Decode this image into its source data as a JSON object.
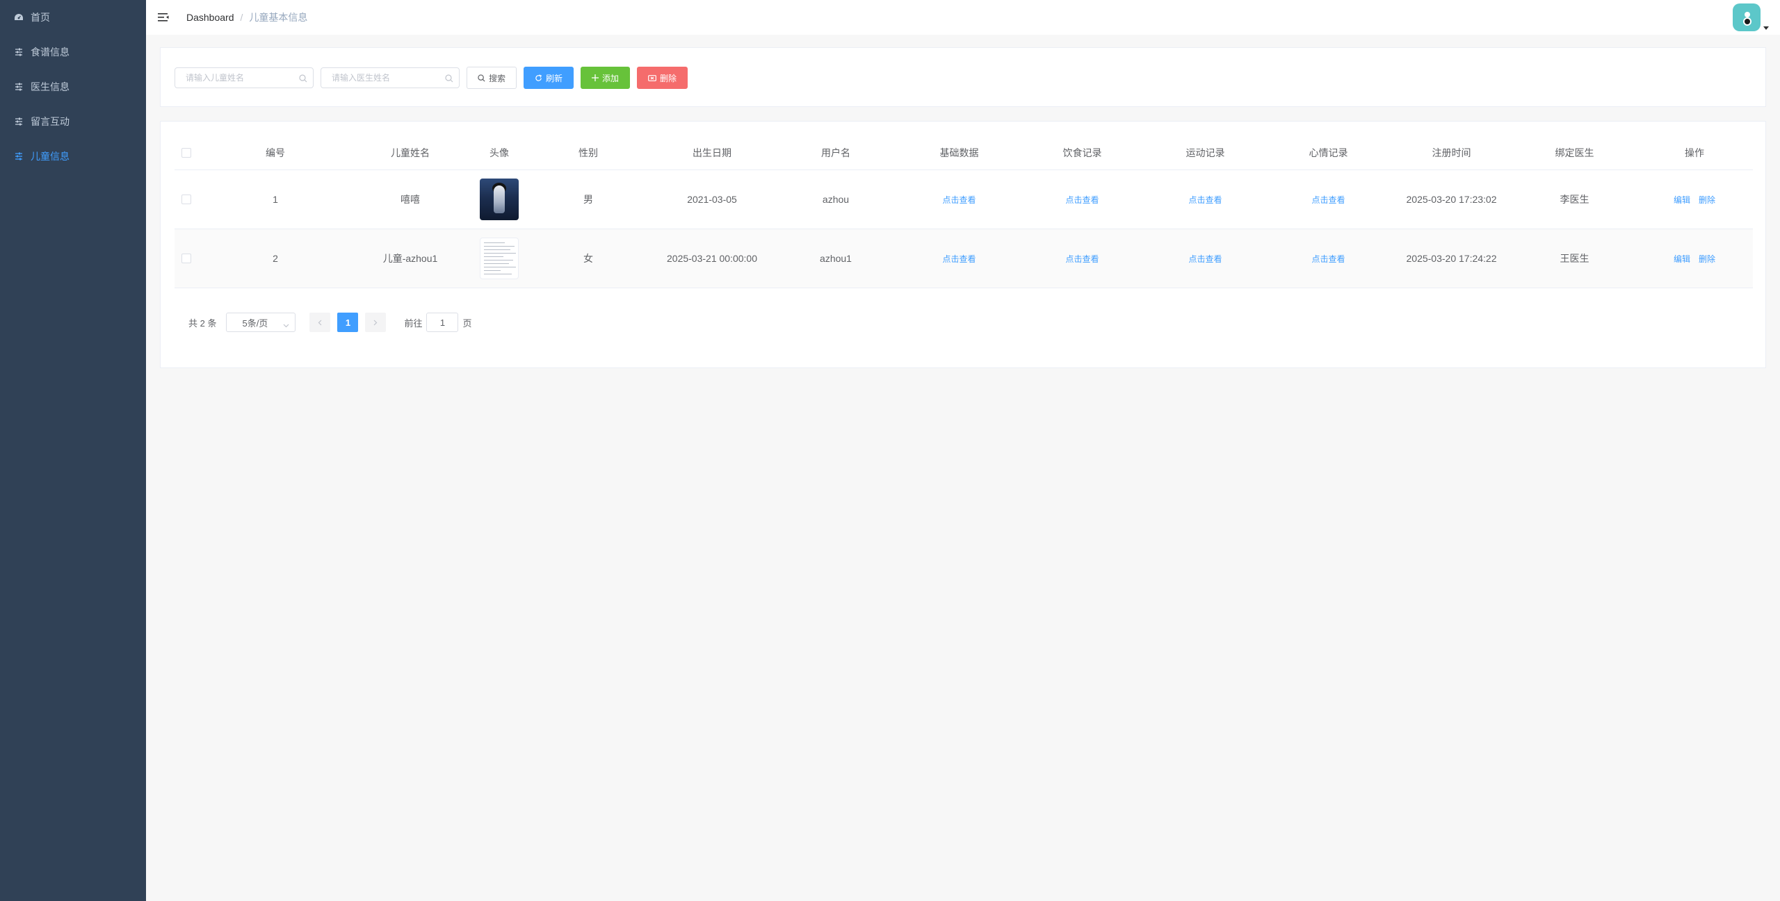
{
  "sidebar": {
    "items": [
      {
        "label": "首页",
        "icon": "dashboard-icon",
        "active": false
      },
      {
        "label": "食谱信息",
        "icon": "sliders-icon",
        "active": false
      },
      {
        "label": "医生信息",
        "icon": "sliders-icon",
        "active": false
      },
      {
        "label": "留言互动",
        "icon": "sliders-icon",
        "active": false
      },
      {
        "label": "儿童信息",
        "icon": "sliders-icon",
        "active": true
      }
    ]
  },
  "navbar": {
    "breadcrumb": {
      "root": "Dashboard",
      "separator": "/",
      "current": "儿童基本信息"
    },
    "avatar_icon": "user-avatar-icon"
  },
  "search": {
    "child_name_placeholder": "请输入儿童姓名",
    "doctor_name_placeholder": "请输入医生姓名",
    "search_label": "搜索",
    "refresh_label": "刷新",
    "add_label": "添加",
    "delete_label": "删除"
  },
  "table": {
    "headers": {
      "no": "编号",
      "name": "儿童姓名",
      "avatar": "头像",
      "sex": "性别",
      "birth": "出生日期",
      "user": "用户名",
      "base": "基础数据",
      "diet": "饮食记录",
      "sport": "运动记录",
      "mood": "心情记录",
      "reg": "注册时间",
      "doctor": "绑定医生",
      "op": "操作"
    },
    "rows": [
      {
        "no": "1",
        "name": "嘻嘻",
        "sex": "男",
        "birth": "2021-03-05",
        "user": "azhou",
        "base": "点击查看",
        "diet": "点击查看",
        "sport": "点击查看",
        "mood": "点击查看",
        "reg": "2025-03-20 17:23:02",
        "doctor": "李医生",
        "edit": "编辑",
        "del": "删除"
      },
      {
        "no": "2",
        "name": "儿童-azhou1",
        "sex": "女",
        "birth": "2025-03-21 00:00:00",
        "user": "azhou1",
        "base": "点击查看",
        "diet": "点击查看",
        "sport": "点击查看",
        "mood": "点击查看",
        "reg": "2025-03-20 17:24:22",
        "doctor": "王医生",
        "edit": "编辑",
        "del": "删除"
      }
    ]
  },
  "pagination": {
    "total": "共 2 条",
    "page_size": "5条/页",
    "current_page": "1",
    "goto_prefix": "前往",
    "goto_value": "1",
    "goto_suffix": "页"
  },
  "colors": {
    "sidebar_bg": "#304156",
    "sidebar_text": "#bfcbd9",
    "accent": "#409eff",
    "success": "#67c23a",
    "danger": "#f56c6c"
  }
}
